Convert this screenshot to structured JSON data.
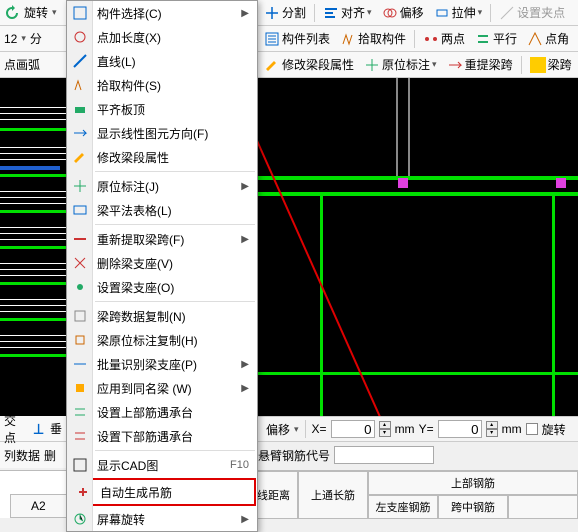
{
  "toolbar": {
    "rotate": "旋转",
    "split": "分割",
    "align": "对齐",
    "offset": "偏移",
    "stretch": "拉伸",
    "setgrip": "设置夹点",
    "complist": "构件列表",
    "pickcomp": "拾取构件",
    "twopoint": "两点",
    "parallel": "平行",
    "pointangle": "点角",
    "modifybeam": "修改梁段属性",
    "origlabel": "原位标注",
    "rebeamspan": "重提梁跨",
    "beamspan": "梁跨",
    "num12": "12",
    "fen": "分",
    "pointarc": "点画弧"
  },
  "leftfrag": {
    "jiaodian": "交点",
    "chui": "垂",
    "lieshuju": "列数据",
    "shan": "删"
  },
  "menu": {
    "items": [
      {
        "label": "构件选择(C)",
        "sub": true
      },
      {
        "label": "点加长度(X)"
      },
      {
        "label": "直线(L)"
      },
      {
        "label": "拾取构件(S)"
      },
      {
        "label": "平齐板顶"
      },
      {
        "label": "显示线性图元方向(F)"
      },
      {
        "label": "修改梁段属性"
      },
      {
        "sep": true
      },
      {
        "label": "原位标注(J)",
        "sub": true
      },
      {
        "label": "梁平法表格(L)"
      },
      {
        "sep": true
      },
      {
        "label": "重新提取梁跨(F)",
        "sub": true
      },
      {
        "label": "删除梁支座(V)"
      },
      {
        "label": "设置梁支座(O)"
      },
      {
        "sep": true
      },
      {
        "label": "梁跨数据复制(N)"
      },
      {
        "label": "梁原位标注复制(H)"
      },
      {
        "label": "批量识别梁支座(P)",
        "sub": true
      },
      {
        "label": "应用到同名梁 (W)",
        "sub": true
      },
      {
        "label": "设置上部筋遇承台"
      },
      {
        "label": "设置下部筋遇承台"
      },
      {
        "sep": true
      },
      {
        "label": "显示CAD图",
        "shortcut": "F10"
      },
      {
        "label": "自动生成吊筋",
        "highlight": true
      },
      {
        "label": "屏幕旋转",
        "sub": true
      }
    ]
  },
  "status": {
    "pianyi": "偏移",
    "x": "X=",
    "y": "Y=",
    "xval": "0",
    "yval": "0",
    "mm": "mm",
    "rotate": "旋转"
  },
  "rebar": {
    "label": "悬臂钢筋代号"
  },
  "table": {
    "a2": "A2",
    "edgedist": "边线距离",
    "toplong": "上通长筋",
    "topsteel": "上部钢筋",
    "leftsup": "左支座钢筋",
    "midspan": "跨中钢筋"
  }
}
